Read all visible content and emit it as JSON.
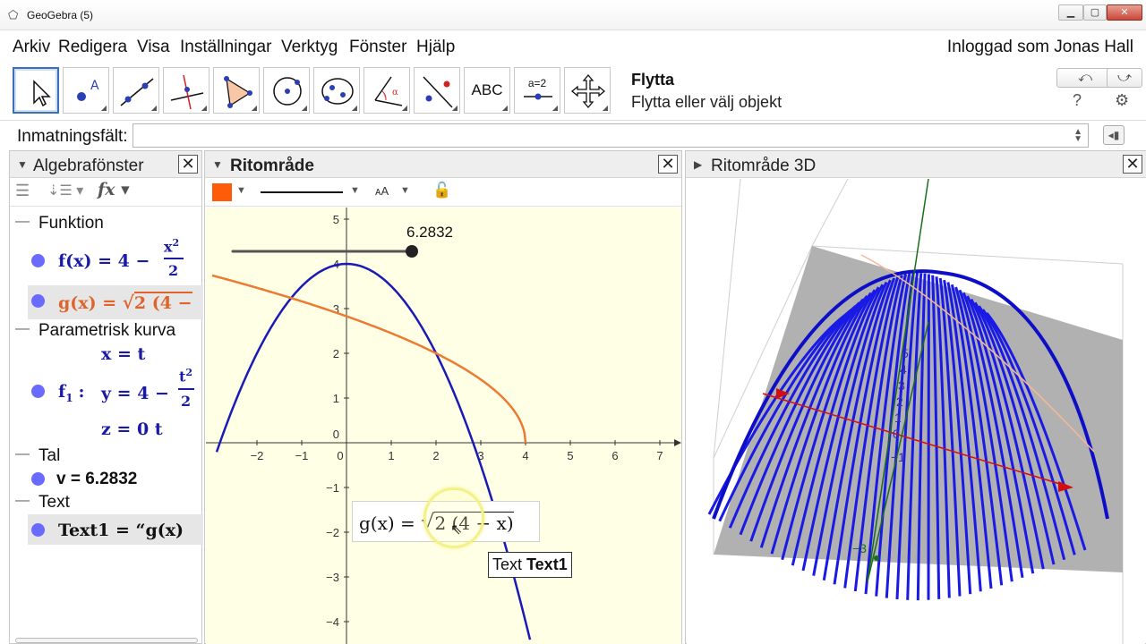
{
  "window": {
    "title": "GeoGebra (5)"
  },
  "menu": {
    "items": [
      "Arkiv",
      "Redigera",
      "Visa",
      "Inställningar",
      "Verktyg",
      "Fönster",
      "Hjälp"
    ],
    "login": "Inloggad som Jonas Hall"
  },
  "toolbar": {
    "tool_text_label": "ABC",
    "tool_slider_label": "a=2",
    "help_title": "Flytta",
    "help_desc": "Flytta eller välj objekt"
  },
  "input_bar": {
    "label": "Inmatningsfält:",
    "value": ""
  },
  "algebra": {
    "title": "Algebrafönster",
    "groups": {
      "funktion": "Funktion",
      "parametrisk": "Parametrisk kurva",
      "tal": "Tal",
      "text": "Text"
    },
    "items": {
      "f": {
        "lhs": "f(x) = 4 −",
        "num": "x",
        "exp": "2",
        "den": "2"
      },
      "g": {
        "lhs": "g(x) = ",
        "rest": "2 (4 −"
      },
      "f1": {
        "name": "f",
        "sub": "1",
        "colon": ":",
        "x_line": "x = t",
        "y_lhs": "y = 4 −",
        "y_num": "t",
        "y_exp": "2",
        "y_den": "2",
        "z_line": "z = 0 t"
      },
      "v": "v = 6.2832",
      "text1": "Text1 = “g(x)"
    }
  },
  "graphics": {
    "title": "Ritområde",
    "slider_value": "6.2832",
    "text_box": {
      "lhs": "g(x) = ",
      "radical": "2 (4 − x)"
    },
    "tooltip": {
      "prefix": "Text ",
      "name": "Text1"
    },
    "x_ticks": [
      "−2",
      "−1",
      "0",
      "1",
      "2",
      "3",
      "4",
      "5",
      "6",
      "7"
    ],
    "y_ticks": [
      "5",
      "4",
      "3",
      "2",
      "1",
      "0",
      "−1",
      "−2",
      "−3",
      "−4"
    ],
    "colors": {
      "f": "#1a1ab8",
      "g": "#ec7a32",
      "background": "#ffffe6",
      "swatch": "#ff5c0a"
    }
  },
  "view3d": {
    "title": "Ritområde 3D",
    "axis_labels": [
      "5",
      "4",
      "3",
      "2",
      "1",
      "0",
      "−1",
      "−3"
    ]
  },
  "chart_data": {
    "type": "line",
    "series": [
      {
        "name": "f",
        "x": [
          -2.9,
          -2,
          -1,
          0,
          1,
          2,
          3,
          4.1
        ],
        "values": [
          -0.205,
          2,
          3.5,
          4,
          3.5,
          2,
          -0.5,
          -4.405
        ]
      },
      {
        "name": "g",
        "x": [
          -3,
          -2,
          -1,
          0,
          1,
          2,
          3,
          4
        ],
        "values": [
          3.741,
          3.464,
          3.162,
          2.828,
          2.449,
          2.0,
          1.414,
          0
        ]
      }
    ],
    "xlim": [
      -2.9,
      7.6
    ],
    "ylim": [
      -4.5,
      5.2
    ],
    "grid": false
  }
}
